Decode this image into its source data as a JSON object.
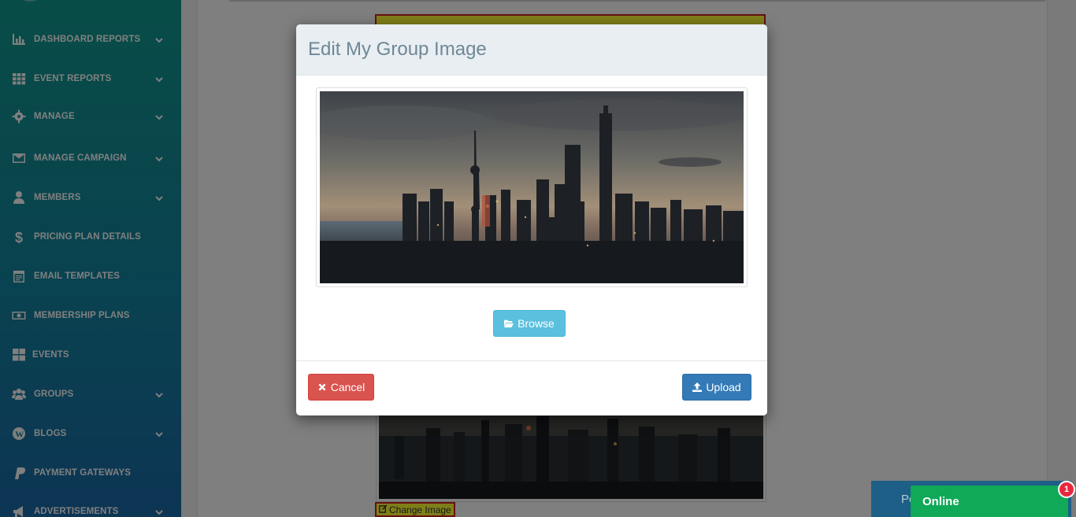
{
  "sidebar": {
    "items": [
      {
        "label": "DASHBOARD REPORTS",
        "icon": "bar-chart-icon",
        "has_chevron": true
      },
      {
        "label": "EVENT REPORTS",
        "icon": "grid-icon",
        "has_chevron": true
      },
      {
        "label": "MANAGE",
        "icon": "gear-icon",
        "has_chevron": true
      },
      {
        "label": "MANAGE CAMPAIGN",
        "icon": "envelope-icon",
        "has_chevron": true
      },
      {
        "label": "MEMBERS",
        "icon": "user-icon",
        "has_chevron": true
      },
      {
        "label": "PRICING PLAN DETAILS",
        "icon": "dollar-icon",
        "has_chevron": false
      },
      {
        "label": "EMAIL TEMPLATES",
        "icon": "calendar-icon",
        "has_chevron": false
      },
      {
        "label": "MEMBERSHIP PLANS",
        "icon": "money-icon",
        "has_chevron": false
      },
      {
        "label": "EVENTS",
        "icon": "tiles-icon",
        "has_chevron": false
      },
      {
        "label": "GROUPS",
        "icon": "users-icon",
        "has_chevron": true
      },
      {
        "label": "BLOGS",
        "icon": "wordpress-icon",
        "has_chevron": true
      },
      {
        "label": "PAYMENT GATEWAYS",
        "icon": "paypal-icon",
        "has_chevron": false
      },
      {
        "label": "ADVERTISEMENTS",
        "icon": "bullhorn-icon",
        "has_chevron": true
      }
    ]
  },
  "background": {
    "change_image_label": "Change Image"
  },
  "modal": {
    "title": "Edit My Group Image",
    "browse_label": "Browse",
    "cancel_label": "Cancel",
    "upload_label": "Upload"
  },
  "chat": {
    "back_label": "Po",
    "status_label": "Online",
    "badge_count": "1"
  },
  "colors": {
    "sidebar_top": "#11998e",
    "sidebar_bottom": "#1a6aa8",
    "browse": "#5bc0de",
    "cancel": "#d9534f",
    "upload": "#337ab7",
    "online": "#0fa958",
    "badge": "#e8283d"
  }
}
